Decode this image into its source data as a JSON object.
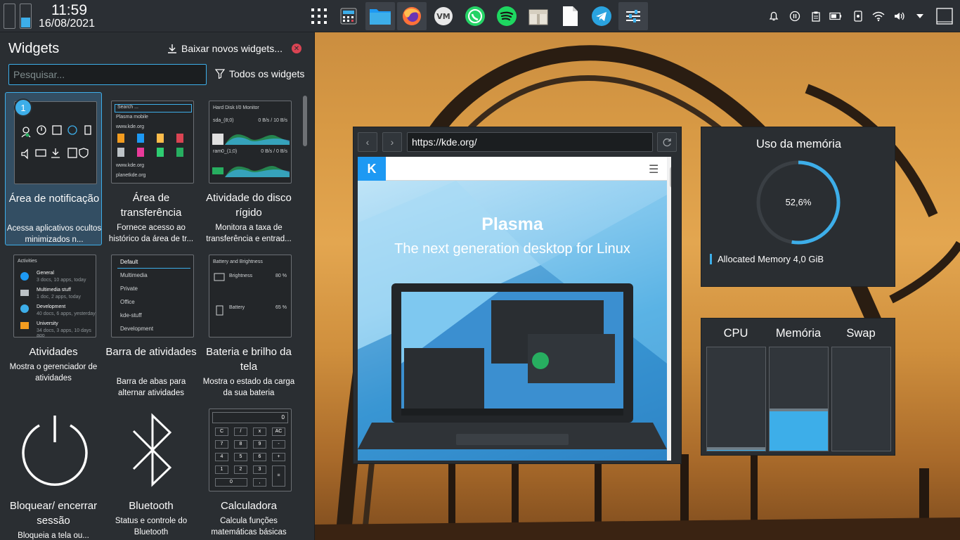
{
  "panel": {
    "clock_time": "11:59",
    "clock_date": "16/08/2021",
    "launcher_icon": "app-grid-icon",
    "tasks": [
      "calculator-icon",
      "file-manager-icon",
      "firefox-icon",
      "vivaldi-icon",
      "whatsapp-icon",
      "spotify-icon",
      "archive-icon",
      "text-file-icon",
      "telegram-icon",
      "settings-icon"
    ],
    "tray": [
      "notifications-icon",
      "media-pause-icon",
      "clipboard-icon",
      "battery-icon",
      "kde-connect-icon",
      "wifi-icon",
      "volume-icon",
      "chevron-down-icon",
      "show-desktop-icon"
    ]
  },
  "explorer": {
    "title": "Widgets",
    "get_new": "Baixar novos widgets...",
    "search_placeholder": "Pesquisar...",
    "filter": "Todos os widgets",
    "cards": [
      {
        "name": "Área de notificação",
        "desc": "Acessa aplicativos ocultos minimizados n...",
        "badge": "1"
      },
      {
        "name": "Área de transferência",
        "desc": "Fornece acesso ao histórico da área de tr..."
      },
      {
        "name": "Atividade do disco rígido",
        "desc": "Monitora a taxa de transferência e entrad..."
      },
      {
        "name": "Atividades",
        "desc": "Mostra o gerenciador de atividades"
      },
      {
        "name": "Barra de atividades",
        "desc": "Barra de abas para alternar atividades"
      },
      {
        "name": "Bateria e brilho da tela",
        "desc": "Mostra o estado da carga da sua bateria"
      },
      {
        "name": "Bloquear/ encerrar sessão",
        "desc": "Bloqueia a tela ou..."
      },
      {
        "name": "Bluetooth",
        "desc": "Status e controle do Bluetooth"
      },
      {
        "name": "Calculadora",
        "desc": "Calcula funções matemáticas básicas"
      }
    ],
    "thumb_clip": {
      "search": "Search ...",
      "items": [
        "Plasma mobile",
        "www.kde.org",
        "www.kde.org",
        "planetkde.org"
      ]
    },
    "thumb_disk": {
      "title": "Hard Disk I/0 Monitor",
      "rows": [
        {
          "dev": "sda_(8;0)",
          "rate": "0 B/s / 10 B/s"
        },
        {
          "dev": "ram0_(1;0)",
          "rate": "0 B/s / 0 B/s"
        }
      ]
    },
    "thumb_activities": {
      "title": "Activities",
      "items": [
        {
          "name": "General",
          "info": "3 docs, 10 apps, today"
        },
        {
          "name": "Multimedia stuff",
          "info": "1 doc, 2 apps, today"
        },
        {
          "name": "Development",
          "info": "40 docs, 6 apps, yesterday"
        },
        {
          "name": "University",
          "info": "34 docs, 3 apps, 10 days ago"
        }
      ]
    },
    "thumb_activitybar": [
      "Default",
      "Multimedia",
      "Private",
      "Office",
      "kde-stuff",
      "Development"
    ],
    "thumb_battery": {
      "title": "Battery and Brightness",
      "brightness_label": "Brightness",
      "brightness_value": "80 %",
      "battery_label": "Battery",
      "battery_value": "65 %"
    },
    "thumb_calc": {
      "display": "0",
      "keys": [
        "C",
        "/",
        "x",
        "AC",
        "7",
        "8",
        "9",
        "-",
        "4",
        "5",
        "6",
        "+",
        "1",
        "2",
        "3",
        "=",
        "0",
        ","
      ]
    }
  },
  "browser": {
    "url": "https://kde.org/",
    "logo": "K",
    "hero_title": "Plasma",
    "hero_subtitle": "The next generation desktop for Linux"
  },
  "memory": {
    "title": "Uso da memória",
    "percent_text": "52,6%",
    "fraction": 0.526,
    "legend": "Allocated Memory 4,0 GiB",
    "accent": "#3daee9"
  },
  "resources": {
    "labels": [
      "CPU",
      "Memória",
      "Swap"
    ],
    "fractions": [
      0.01,
      0.38,
      0.0
    ]
  },
  "colors": {
    "accent": "#3daee9",
    "panel_bg": "#2b2f34",
    "close_red": "#da4453"
  }
}
